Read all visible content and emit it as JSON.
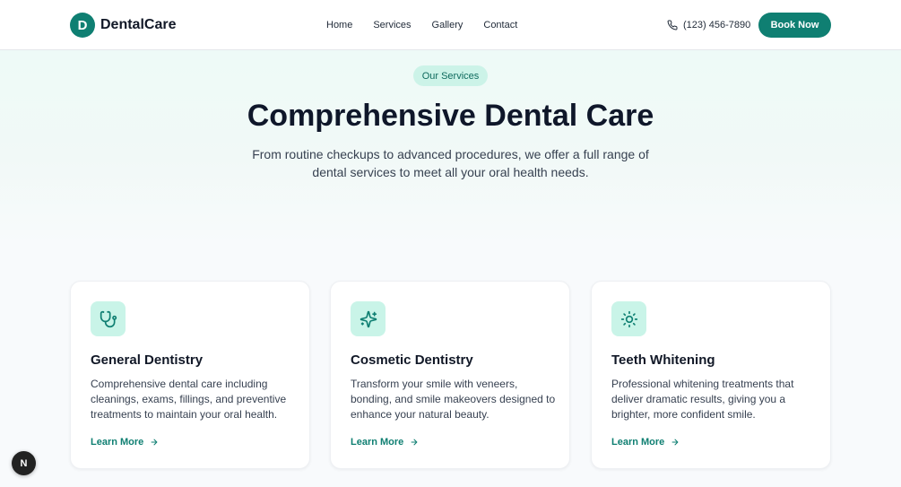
{
  "header": {
    "logo_letter": "D",
    "logo_text": "DentalCare",
    "nav": [
      "Home",
      "Services",
      "Gallery",
      "Contact"
    ],
    "phone": "(123) 456-7890",
    "book_label": "Book Now"
  },
  "hero": {
    "badge": "Our Services",
    "title": "Comprehensive Dental Care",
    "subtitle": "From routine checkups to advanced procedures, we offer a full range of dental services to meet all your oral health needs."
  },
  "services": [
    {
      "icon": "stethoscope-icon",
      "title": "General Dentistry",
      "description": "Comprehensive dental care including cleanings, exams, fillings, and preventive treatments to maintain your oral health.",
      "link": "Learn More"
    },
    {
      "icon": "sparkles-icon",
      "title": "Cosmetic Dentistry",
      "description": "Transform your smile with veneers, bonding, and smile makeovers designed to enhance your natural beauty.",
      "link": "Learn More"
    },
    {
      "icon": "sun-icon",
      "title": "Teeth Whitening",
      "description": "Professional whitening treatments that deliver dramatic results, giving you a brighter, more confident smile.",
      "link": "Learn More"
    }
  ],
  "dev_badge": "N",
  "colors": {
    "brand": "#0f7f72",
    "badge_bg": "#ccf3e8",
    "icon_bg": "#c9f4e8"
  }
}
